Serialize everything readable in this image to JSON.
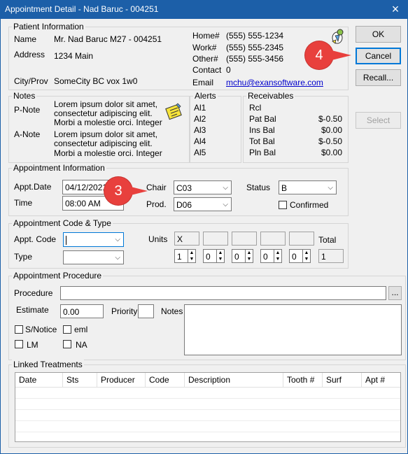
{
  "window": {
    "title": "Appointment Detail - Nad Baruc - 004251",
    "close_icon": "×"
  },
  "buttons": {
    "ok": "OK",
    "cancel": "Cancel",
    "recall": "Recall...",
    "select": "Select",
    "browse": "..."
  },
  "patient": {
    "section_title": "Patient Information",
    "name_label": "Name",
    "name_value": "Mr. Nad Baruc  M27 - 004251",
    "address_label": "Address",
    "address_value": "1234 Main",
    "city_label": "City/Prov",
    "city_value": "SomeCity BC vox 1w0",
    "home_label": "Home#",
    "home_value": "(555) 555-1234",
    "work_label": "Work#",
    "work_value": "(555) 555-2345",
    "other_label": "Other#",
    "other_value": "(555) 555-3456",
    "contact_label": "Contact",
    "contact_value": "0",
    "email_label": "Email",
    "email_value": "mchu@exansoftware.com"
  },
  "notes": {
    "section_title": "Notes",
    "pnote_label": "P-Note",
    "pnote_lines": [
      "Lorem ipsum dolor sit amet,",
      "consectetur adipiscing elit.",
      "Morbi a molestie orci. Integer"
    ],
    "anote_label": "A-Note",
    "anote_lines": [
      "Lorem ipsum dolor sit amet,",
      "consectetur adipiscing elit.",
      "Morbi a molestie orci. Integer"
    ]
  },
  "alerts": {
    "section_title": "Alerts",
    "items": [
      "Al1",
      "Al2",
      "Al3",
      "Al4",
      "Al5"
    ]
  },
  "receivables": {
    "section_title": "Receivables",
    "rcl_label": "Rcl",
    "rows": [
      {
        "label": "Pat Bal",
        "value": "$-0.50"
      },
      {
        "label": "Ins Bal",
        "value": "$0.00"
      },
      {
        "label": "Tot Bal",
        "value": "$-0.50"
      },
      {
        "label": "Pln Bal",
        "value": "$0.00"
      }
    ]
  },
  "appointment": {
    "section_title": "Appointment Information",
    "date_label": "Appt.Date",
    "date_value": "04/12/2021",
    "time_label": "Time",
    "time_value": "08:00 AM",
    "chair_label": "Chair",
    "chair_value": "C03",
    "prod_label": "Prod.",
    "prod_value": "D06",
    "status_label": "Status",
    "status_value": "B",
    "confirmed_label": "Confirmed",
    "confirmed_checked": false
  },
  "code_type": {
    "section_title": "Appointment Code & Type",
    "code_label": "Appt. Code",
    "code_value": "",
    "type_label": "Type",
    "type_value": "",
    "units_label": "Units",
    "unit_boxes": [
      "X",
      "",
      "",
      "",
      ""
    ],
    "spinners": [
      "1",
      "0",
      "0",
      "0",
      "0"
    ],
    "total_label": "Total",
    "total_value": "1"
  },
  "procedure": {
    "section_title": "Appointment Procedure",
    "procedure_label": "Procedure",
    "procedure_value": "",
    "estimate_label": "Estimate",
    "estimate_value": "0.00",
    "priority_label": "Priority",
    "priority_value": "",
    "notes_label": "Notes",
    "notes_value": "",
    "snotice_label": "S/Notice",
    "eml_label": "eml",
    "lm_label": "LM",
    "na_label": "NA"
  },
  "linked": {
    "section_title": "Linked Treatments",
    "columns": [
      "Date",
      "Sts",
      "Producer",
      "Code",
      "Description",
      "Tooth #",
      "Surf",
      "Apt #"
    ]
  },
  "callouts": [
    "3",
    "4"
  ],
  "icons": {
    "arrow_down": "▼",
    "arrow_up": "▲",
    "note_icon": "sticky-note-icon",
    "patient_icon": "patient-figure-icon"
  },
  "colors": {
    "titlebar": "#1c5fa8",
    "callout": "#e8403d",
    "link": "#0000cc",
    "note_yellow": "#f7e43a"
  }
}
